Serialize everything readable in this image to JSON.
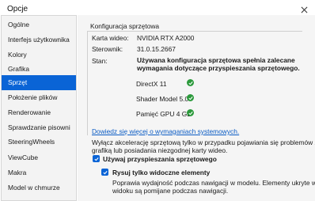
{
  "window": {
    "title": "Opcje"
  },
  "sidebar": {
    "items": [
      {
        "label": "Ogólne"
      },
      {
        "label": "Interfejs użytkownika"
      },
      {
        "label": "Kolory"
      },
      {
        "label": "Grafika"
      },
      {
        "label": "Sprzęt"
      },
      {
        "label": "Położenie plików"
      },
      {
        "label": "Renderowanie"
      },
      {
        "label": "Sprawdzanie pisowni"
      },
      {
        "label": "SteeringWheels"
      },
      {
        "label": "ViewCube"
      },
      {
        "label": "Makra"
      },
      {
        "label": "Model w chmurze"
      }
    ],
    "active": "Sprzęt"
  },
  "hardware": {
    "group_title": "Konfiguracja sprzętowa",
    "graphics_card_label": "Karta wideo:",
    "graphics_card_value": "NVIDIA RTX A2000",
    "driver_label": "Sterownik:",
    "driver_value": "31.0.15.2667",
    "status_label": "Stan:",
    "status_line1": "Używana konfiguracja sprzętowa spełnia zalecane",
    "status_line2": "wymagania dotyczące przyspieszania sprzętowego.",
    "capabilities": [
      {
        "label": "DirectX 11",
        "icon": "check-circle-icon"
      },
      {
        "label": "Shader Model 5.0",
        "icon": "check-circle-icon"
      },
      {
        "label": "Pamięć GPU 4 GB",
        "icon": "check-circle-icon"
      }
    ]
  },
  "link_text": "Dowiedz się więcej o wymaganiach systemowych.",
  "note_lines": [
    "Wyłącz akcelerację sprzętową tylko w przypadku pojawiania się problemów z",
    "grafiką lub posiadania niezgodnej karty wideo."
  ],
  "use_hw_accel": {
    "label": "Używaj przyspieszania sprzętowego",
    "checked": true
  },
  "render_visible": {
    "label": "Rysuj tylko widoczne elementy",
    "checked": true,
    "desc_lines": [
      "Poprawia wydajność podczas nawigacji w modelu. Elementy ukryte w",
      "widoku są pomijane podczas nawigacji."
    ]
  },
  "colors": {
    "accent": "#0a64d6",
    "success": "#2c9a3c",
    "link": "#0a5bc4"
  }
}
